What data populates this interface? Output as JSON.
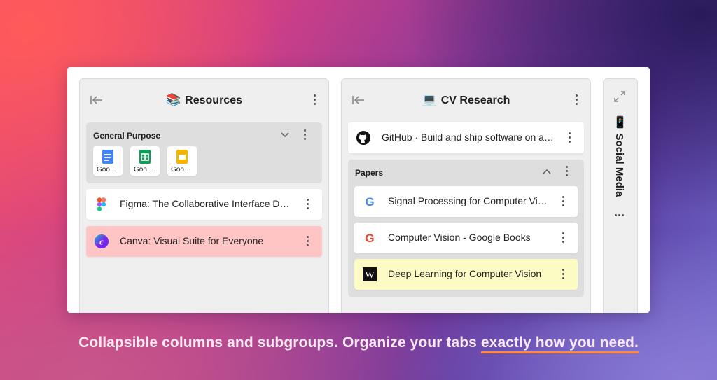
{
  "columns": [
    {
      "title": "Resources",
      "emoji": "📚",
      "group": {
        "title": "General Purpose",
        "mini_tabs": [
          {
            "label": "Goo…",
            "icon": "google-docs-icon",
            "color": "#4285f4"
          },
          {
            "label": "Goo…",
            "icon": "google-sheets-icon",
            "color": "#0f9d58"
          },
          {
            "label": "Goo…",
            "icon": "google-slides-icon",
            "color": "#f4b400"
          }
        ]
      },
      "tabs": [
        {
          "title": "Figma: The Collaborative Interface Design Tool",
          "icon": "figma-icon"
        },
        {
          "title": "Canva: Visual Suite for Everyone",
          "icon": "canva-icon",
          "highlight": "#ffc4c4"
        }
      ]
    },
    {
      "title": "CV Research",
      "emoji": "💻",
      "tabs": [
        {
          "title": "GitHub · Build and ship software on a single platform",
          "icon": "github-icon"
        }
      ],
      "group": {
        "title": "Papers",
        "tabs": [
          {
            "title": "Signal Processing for Computer Vision",
            "icon": "google-icon"
          },
          {
            "title": "Computer Vision - Google Books",
            "icon": "google-icon"
          },
          {
            "title": "Deep Learning for Computer Vision",
            "icon": "wikipedia-icon",
            "highlight": "#fdfbc4"
          }
        ]
      }
    },
    {
      "title": "Social Media",
      "emoji": "📱",
      "collapsed": true
    }
  ],
  "caption": {
    "text": "Collapsible columns and subgroups. Organize your tabs ",
    "highlight": "exactly how you need."
  }
}
